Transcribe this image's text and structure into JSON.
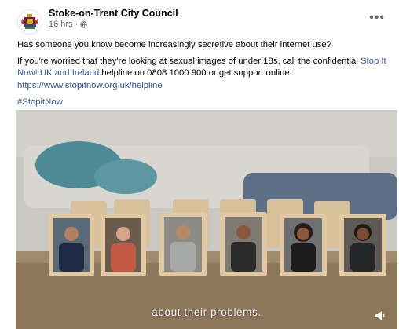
{
  "post": {
    "page_name": "Stoke-on-Trent City Council",
    "time": "16 hrs ·",
    "line1": "Has someone you know become increasingly secretive about their internet use?",
    "line2_prefix": "If you're worried that they're looking at sexual images of under 18s, call the confidential ",
    "line2_link": "Stop It Now! UK and Ireland",
    "line2_suffix": " helpline on 0808 1000 900 or get support online:",
    "url": "https://www.stopitnow.org.uk/helpline",
    "hashtag": "#StopitNow"
  },
  "video": {
    "caption": "about their problems."
  },
  "icons": {
    "avatar": "council-crest-icon",
    "audience": "globe-icon",
    "more": "more-options-icon",
    "volume": "volume-icon"
  },
  "colors": {
    "link": "#385898",
    "meta": "#65676b",
    "text": "#050505"
  }
}
